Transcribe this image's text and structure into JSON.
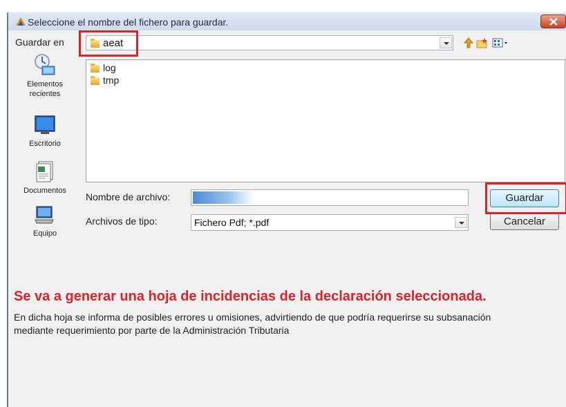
{
  "dialog": {
    "title": "Seleccione el nombre del fichero para guardar.",
    "save_in_label": "Guardar en",
    "current_folder": "aeat"
  },
  "places": [
    {
      "label_line1": "Elementos",
      "label_line2": "recientes",
      "icon": "recent-items-icon"
    },
    {
      "label_line1": "Escritorio",
      "label_line2": "",
      "icon": "desktop-icon"
    },
    {
      "label_line1": "Documentos",
      "label_line2": "",
      "icon": "documents-icon"
    },
    {
      "label_line1": "Equipo",
      "label_line2": "",
      "icon": "computer-icon"
    }
  ],
  "files": [
    {
      "name": "log",
      "icon": "folder-icon"
    },
    {
      "name": "tmp",
      "icon": "folder-icon"
    }
  ],
  "form": {
    "filename_label": "Nombre de archivo:",
    "filetype_label": "Archivos de tipo:",
    "filetype_value": "Fichero Pdf; *.pdf"
  },
  "buttons": {
    "save": "Guardar",
    "cancel": "Cancelar"
  },
  "notice": {
    "title": "Se va a generar una hoja de incidencias de la declaración seleccionada.",
    "line1": "En dicha hoja se informa de posibles errores u omisiones, advirtiendo de que podría requerirse su subsanación",
    "line2": "mediante requerimiento por parte de la Administración Tributaria"
  },
  "colors": {
    "highlight": "#d8242a",
    "notice_title": "#d8242a",
    "dialog_bg": "#f0f0f0"
  }
}
